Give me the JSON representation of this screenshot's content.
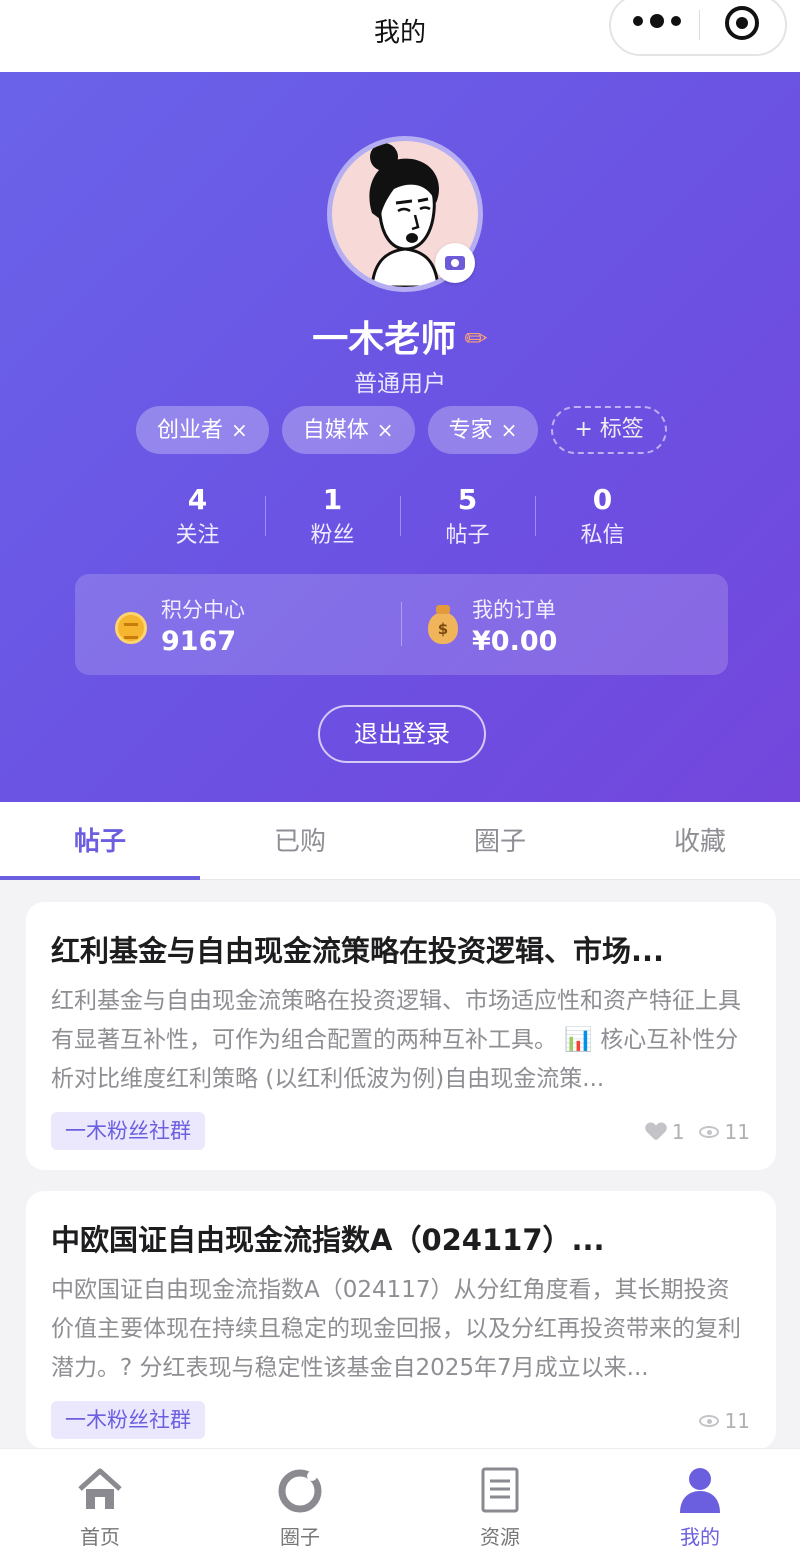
{
  "nav": {
    "title": "我的"
  },
  "profile": {
    "name": "一木老师",
    "role": "普通用户",
    "tags": [
      "创业者",
      "自媒体",
      "专家"
    ],
    "add_tag_label": "+ 标签",
    "tag_remove_glyph": "×",
    "edit_glyph": "✏"
  },
  "stats": [
    {
      "num": "4",
      "label": "关注"
    },
    {
      "num": "1",
      "label": "粉丝"
    },
    {
      "num": "5",
      "label": "帖子"
    },
    {
      "num": "0",
      "label": "私信"
    }
  ],
  "cards": {
    "points_label": "积分中心",
    "points_value": "9167",
    "orders_label": "我的订单",
    "orders_value": "¥0.00",
    "bag_glyph": "$"
  },
  "logout_label": "退出登录",
  "tabs": [
    "帖子",
    "已购",
    "圈子",
    "收藏"
  ],
  "posts": [
    {
      "title": "红利基金与自由现金流策略在投资逻辑、市场...",
      "body": "红利基金与自由现金流策略在投资逻辑、市场适应性和资产特征上具有显著互补性，可作为组合配置的两种互补工具。 📊 核心互补性分析对比维度红利策略 (以红利低波为例)自由现金流策...",
      "chip": "一木粉丝社群",
      "likes": "1",
      "views": "11"
    },
    {
      "title": "中欧国证自由现金流指数A（024117）...",
      "body": "中欧国证自由现金流指数A（024117）从分红角度看，其长期投资价值主要体现在持续且稳定的现金回报，以及分红再投资带来的复利潜力。? 分红表现与稳定性该基金自2025年7月成立以来...",
      "chip": "一木粉丝社群",
      "views": "11"
    }
  ],
  "tabbar": [
    "首页",
    "圈子",
    "资源",
    "我的"
  ],
  "colors": {
    "accent": "#6b5fe0",
    "hero_start": "#6a63e9",
    "hero_end": "#7346dc"
  }
}
